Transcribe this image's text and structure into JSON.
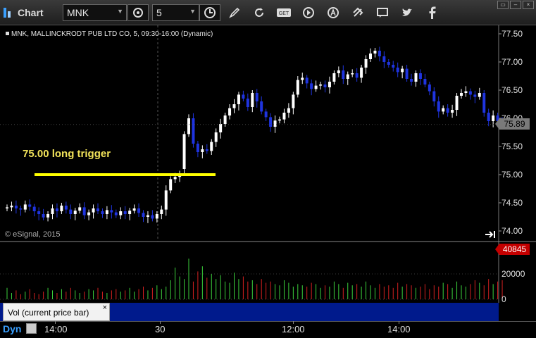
{
  "toolbar": {
    "title": "Chart",
    "symbol": "MNK",
    "interval": "5",
    "icons": [
      "refresh-icon",
      "history-icon",
      "draw-pencil-icon",
      "cursor-icon",
      "get-icon",
      "play-icon",
      "alert-icon",
      "link-icon",
      "comment-icon",
      "twitter-icon",
      "facebook-icon"
    ]
  },
  "window_controls": [
    "restore-window-icon",
    "minimize-window-icon",
    "close-window-icon"
  ],
  "chart": {
    "info_label": "MNK, MALLINCKRODT PUB LTD CO, 5, 09:30-16:00 (Dynamic)",
    "copyright": "© eSignal, 2015",
    "annotation": "75.00 long trigger",
    "last_price": "75.89",
    "price_ticks": [
      "77.50",
      "77.00",
      "76.50",
      "76.00",
      "75.50",
      "75.00",
      "74.50",
      "74.00"
    ],
    "colors": {
      "up": "#ffffff",
      "down": "#1f34e0",
      "trigger": "#ffff00",
      "vol_up": "#3cd13c",
      "vol_down": "#d42020"
    }
  },
  "volume": {
    "legend": "Vol (current price bar)",
    "close_label": "×",
    "last_value": "40845",
    "ticks": [
      "20000",
      "0"
    ]
  },
  "time_axis": {
    "mode": "Dyn",
    "ticks": [
      "14:00",
      "30",
      "12:00",
      "14:00"
    ]
  },
  "chart_data": {
    "type": "candlestick",
    "ylim": [
      73.9,
      77.6
    ],
    "trigger_level": 75.0,
    "last_price": 75.89,
    "volume_ylim": [
      0,
      40000
    ],
    "volume_last": 40845
  }
}
